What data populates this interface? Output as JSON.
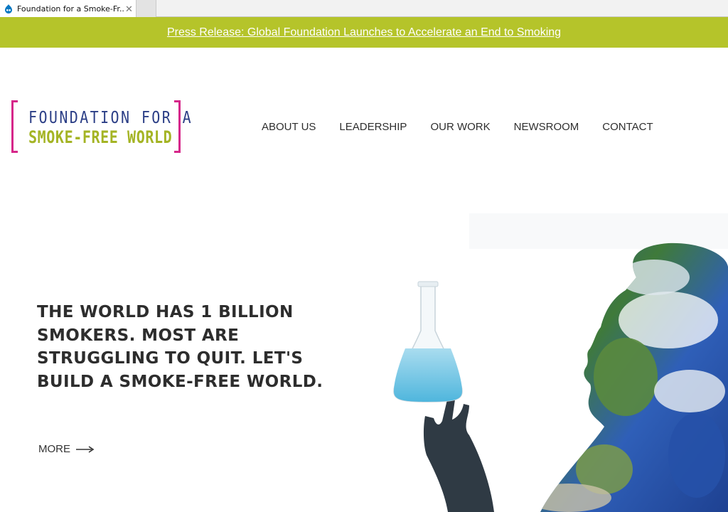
{
  "browser": {
    "tab_title": "Foundation for a Smoke-Fr...",
    "tab_close": "✕"
  },
  "banner": {
    "link_text": "Press Release: Global Foundation Launches to Accelerate an End to Smoking",
    "background": "#b5c42a"
  },
  "logo": {
    "line1": "FOUNDATION FOR A",
    "line2": "SMOKE-FREE WORLD",
    "bracket_color": "#d6278a",
    "line1_color": "#2b3e86",
    "line2_color": "#a4b424"
  },
  "nav": {
    "items": [
      "ABOUT US",
      "LEADERSHIP",
      "OUR WORK",
      "NEWSROOM",
      "CONTACT"
    ]
  },
  "hero": {
    "headline": "THE WORLD HAS 1 BILLION SMOKERS. MOST ARE STRUGGLING TO QUIT. LET'S BUILD A SMOKE-FREE WORLD.",
    "more_label": "MORE",
    "image_subject": "person-silhouette-earth-holding-flask"
  }
}
